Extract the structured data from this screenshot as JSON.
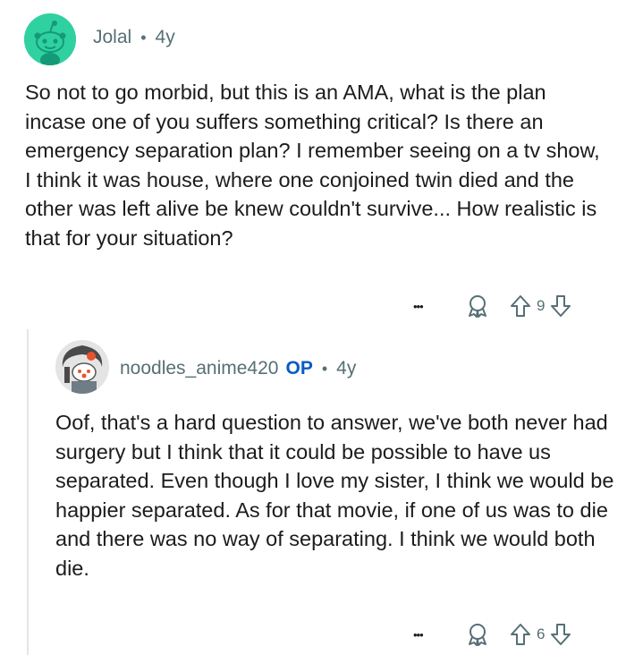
{
  "comment1": {
    "username": "Jolal",
    "age": "4y",
    "text": "So not to go morbid, but this is an AMA, what is the plan incase one of you suffers something critical?  Is there an emergency separation plan?  I remember seeing on a tv show, I think it was house, where one conjoined twin died and the other was left alive be knew couldn't survive...  How realistic is that for your situation?",
    "more_label": "•••",
    "votes": "9"
  },
  "comment2": {
    "username": "noodles_anime420",
    "op_badge": "OP",
    "age": "4y",
    "text": "Oof, that's a hard question to answer, we've both never had surgery but I think that it could be possible to have us separated. Even though I love my sister, I think we would be happier separated. As for that movie, if one of us was to die and there was no way of separating. I think we would both die.",
    "more_label": "•••",
    "votes": "6"
  },
  "separator": "•",
  "colors": {
    "accent": "#0a5bc4",
    "avatar_green": "#2fd1a0",
    "meta": "#576f76"
  }
}
